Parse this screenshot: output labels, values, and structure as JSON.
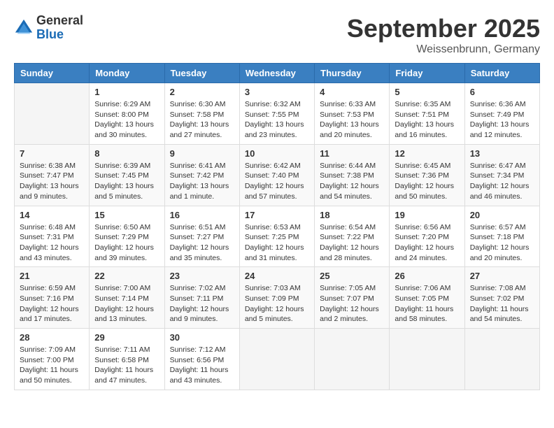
{
  "logo": {
    "general": "General",
    "blue": "Blue"
  },
  "title": "September 2025",
  "location": "Weissenbrunn, Germany",
  "days_of_week": [
    "Sunday",
    "Monday",
    "Tuesday",
    "Wednesday",
    "Thursday",
    "Friday",
    "Saturday"
  ],
  "weeks": [
    [
      {
        "day": "",
        "info": ""
      },
      {
        "day": "1",
        "info": "Sunrise: 6:29 AM\nSunset: 8:00 PM\nDaylight: 13 hours\nand 30 minutes."
      },
      {
        "day": "2",
        "info": "Sunrise: 6:30 AM\nSunset: 7:58 PM\nDaylight: 13 hours\nand 27 minutes."
      },
      {
        "day": "3",
        "info": "Sunrise: 6:32 AM\nSunset: 7:55 PM\nDaylight: 13 hours\nand 23 minutes."
      },
      {
        "day": "4",
        "info": "Sunrise: 6:33 AM\nSunset: 7:53 PM\nDaylight: 13 hours\nand 20 minutes."
      },
      {
        "day": "5",
        "info": "Sunrise: 6:35 AM\nSunset: 7:51 PM\nDaylight: 13 hours\nand 16 minutes."
      },
      {
        "day": "6",
        "info": "Sunrise: 6:36 AM\nSunset: 7:49 PM\nDaylight: 13 hours\nand 12 minutes."
      }
    ],
    [
      {
        "day": "7",
        "info": "Sunrise: 6:38 AM\nSunset: 7:47 PM\nDaylight: 13 hours\nand 9 minutes."
      },
      {
        "day": "8",
        "info": "Sunrise: 6:39 AM\nSunset: 7:45 PM\nDaylight: 13 hours\nand 5 minutes."
      },
      {
        "day": "9",
        "info": "Sunrise: 6:41 AM\nSunset: 7:42 PM\nDaylight: 13 hours\nand 1 minute."
      },
      {
        "day": "10",
        "info": "Sunrise: 6:42 AM\nSunset: 7:40 PM\nDaylight: 12 hours\nand 57 minutes."
      },
      {
        "day": "11",
        "info": "Sunrise: 6:44 AM\nSunset: 7:38 PM\nDaylight: 12 hours\nand 54 minutes."
      },
      {
        "day": "12",
        "info": "Sunrise: 6:45 AM\nSunset: 7:36 PM\nDaylight: 12 hours\nand 50 minutes."
      },
      {
        "day": "13",
        "info": "Sunrise: 6:47 AM\nSunset: 7:34 PM\nDaylight: 12 hours\nand 46 minutes."
      }
    ],
    [
      {
        "day": "14",
        "info": "Sunrise: 6:48 AM\nSunset: 7:31 PM\nDaylight: 12 hours\nand 43 minutes."
      },
      {
        "day": "15",
        "info": "Sunrise: 6:50 AM\nSunset: 7:29 PM\nDaylight: 12 hours\nand 39 minutes."
      },
      {
        "day": "16",
        "info": "Sunrise: 6:51 AM\nSunset: 7:27 PM\nDaylight: 12 hours\nand 35 minutes."
      },
      {
        "day": "17",
        "info": "Sunrise: 6:53 AM\nSunset: 7:25 PM\nDaylight: 12 hours\nand 31 minutes."
      },
      {
        "day": "18",
        "info": "Sunrise: 6:54 AM\nSunset: 7:22 PM\nDaylight: 12 hours\nand 28 minutes."
      },
      {
        "day": "19",
        "info": "Sunrise: 6:56 AM\nSunset: 7:20 PM\nDaylight: 12 hours\nand 24 minutes."
      },
      {
        "day": "20",
        "info": "Sunrise: 6:57 AM\nSunset: 7:18 PM\nDaylight: 12 hours\nand 20 minutes."
      }
    ],
    [
      {
        "day": "21",
        "info": "Sunrise: 6:59 AM\nSunset: 7:16 PM\nDaylight: 12 hours\nand 17 minutes."
      },
      {
        "day": "22",
        "info": "Sunrise: 7:00 AM\nSunset: 7:14 PM\nDaylight: 12 hours\nand 13 minutes."
      },
      {
        "day": "23",
        "info": "Sunrise: 7:02 AM\nSunset: 7:11 PM\nDaylight: 12 hours\nand 9 minutes."
      },
      {
        "day": "24",
        "info": "Sunrise: 7:03 AM\nSunset: 7:09 PM\nDaylight: 12 hours\nand 5 minutes."
      },
      {
        "day": "25",
        "info": "Sunrise: 7:05 AM\nSunset: 7:07 PM\nDaylight: 12 hours\nand 2 minutes."
      },
      {
        "day": "26",
        "info": "Sunrise: 7:06 AM\nSunset: 7:05 PM\nDaylight: 11 hours\nand 58 minutes."
      },
      {
        "day": "27",
        "info": "Sunrise: 7:08 AM\nSunset: 7:02 PM\nDaylight: 11 hours\nand 54 minutes."
      }
    ],
    [
      {
        "day": "28",
        "info": "Sunrise: 7:09 AM\nSunset: 7:00 PM\nDaylight: 11 hours\nand 50 minutes."
      },
      {
        "day": "29",
        "info": "Sunrise: 7:11 AM\nSunset: 6:58 PM\nDaylight: 11 hours\nand 47 minutes."
      },
      {
        "day": "30",
        "info": "Sunrise: 7:12 AM\nSunset: 6:56 PM\nDaylight: 11 hours\nand 43 minutes."
      },
      {
        "day": "",
        "info": ""
      },
      {
        "day": "",
        "info": ""
      },
      {
        "day": "",
        "info": ""
      },
      {
        "day": "",
        "info": ""
      }
    ]
  ]
}
